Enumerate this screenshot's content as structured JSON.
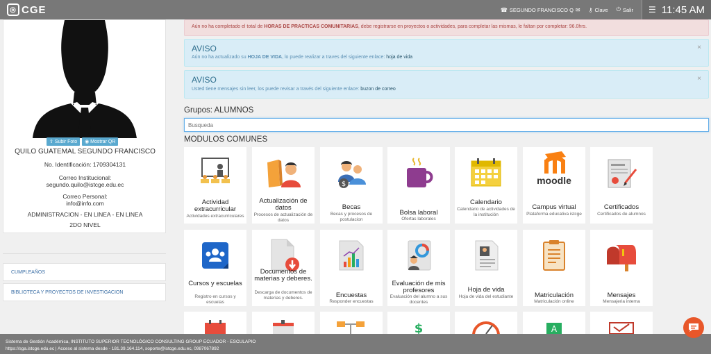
{
  "header": {
    "logo": "CGE",
    "user": "SEGUNDO FRANCISCO Q",
    "password_label": "Clave",
    "exit_label": "Salir",
    "time": "11:45 AM"
  },
  "profile": {
    "upload_photo": "Subir Foto",
    "show_qr": "Mostrar QR",
    "name": "QUILO GUATEMAL SEGUNDO FRANCISCO",
    "id_line": "No. Identificación: 1709304131",
    "inst_email_label": "Correo Institucional:",
    "inst_email": "segundo.quilo@istcge.edu.ec",
    "personal_email_label": "Correo Personal:",
    "personal_email": "info@info.com",
    "program": "ADMINISTRACION - EN LINEA - EN LINEA",
    "level": "2DO NIVEL"
  },
  "sidebar_links": [
    "CUMPLEAÑOS",
    "BIBLIOTECA Y PROYECTOS DE INVESTIGACION"
  ],
  "alerts": {
    "a1_text_pre": "Aún no ha completado el total de ",
    "a1_text_bold": "HORAS DE PRACTICAS COMUNITARIAS",
    "a1_text_post": ", debe registrarse en proyectos o actividades, para completar las mismas, le faltan por completar: 96.0hrs.",
    "a2_title": "AVISO",
    "a2_pre": "Aún no ha actualizado su ",
    "a2_bold": "HOJA DE VIDA",
    "a2_post": ", lo puede realizar a traves del siguiente enlace: ",
    "a2_link": "hoja de vida",
    "a3_title": "AVISO",
    "a3_pre": "Usted tiene mensajes sin leer, los puede revisar a través del siguiente enlace: ",
    "a3_link": "buzon de correo"
  },
  "groups_label": "Grupos: ALUMNOS",
  "search_placeholder": "Busqueda",
  "modules_title": "MODULOS COMUNES",
  "modules_row1": [
    {
      "title": "Actividad extracurricular",
      "desc": "Actividades extracurriculares"
    },
    {
      "title": "Actualización de datos",
      "desc": "Procesos de actualización de datos"
    },
    {
      "title": "Becas",
      "desc": "Becas y procesos de postulacion"
    },
    {
      "title": "Bolsa laboral",
      "desc": "Ofertas laborales"
    },
    {
      "title": "Calendario",
      "desc": "Calendario de actividades de la institución"
    },
    {
      "title": "Campus virtual",
      "desc": "Plataforma educativa istcge"
    },
    {
      "title": "Certificados",
      "desc": "Certificados de alumnos"
    }
  ],
  "modules_row2": [
    {
      "title": "Cursos y escuelas",
      "desc": "Registro en cursos y escuelas"
    },
    {
      "title": "Documentos de materias y deberes.",
      "desc": "Descarga de documentos de materias y deberes."
    },
    {
      "title": "Encuestas",
      "desc": "Responder encuestas"
    },
    {
      "title": "Evaluación de mis profesores",
      "desc": "Evaluación del alumno a sus docentes"
    },
    {
      "title": "Hoja de vida",
      "desc": "Hoja de vida del estudiante"
    },
    {
      "title": "Matriculación",
      "desc": "Matriculación online"
    },
    {
      "title": "Mensajes",
      "desc": "Mensajeria interna"
    }
  ],
  "moodle_word": "moodle",
  "footer": {
    "line1": "Sistema de Gestión Académica, INSTITUTO SUPERIOR TECNOLÓGICO CONSULTING GROUP ECUADOR - ESCULAPIO",
    "line2": "https://sga.istcge.edu.ec | Acceso al sistema desde - 181.39.164.114, soporte@istcge.edu.ec, 0987067892"
  },
  "colors": {
    "topbar": "#787878",
    "alert_blue": "#d9edf7",
    "alert_red": "#f2dede",
    "chat": "#e8572a"
  }
}
